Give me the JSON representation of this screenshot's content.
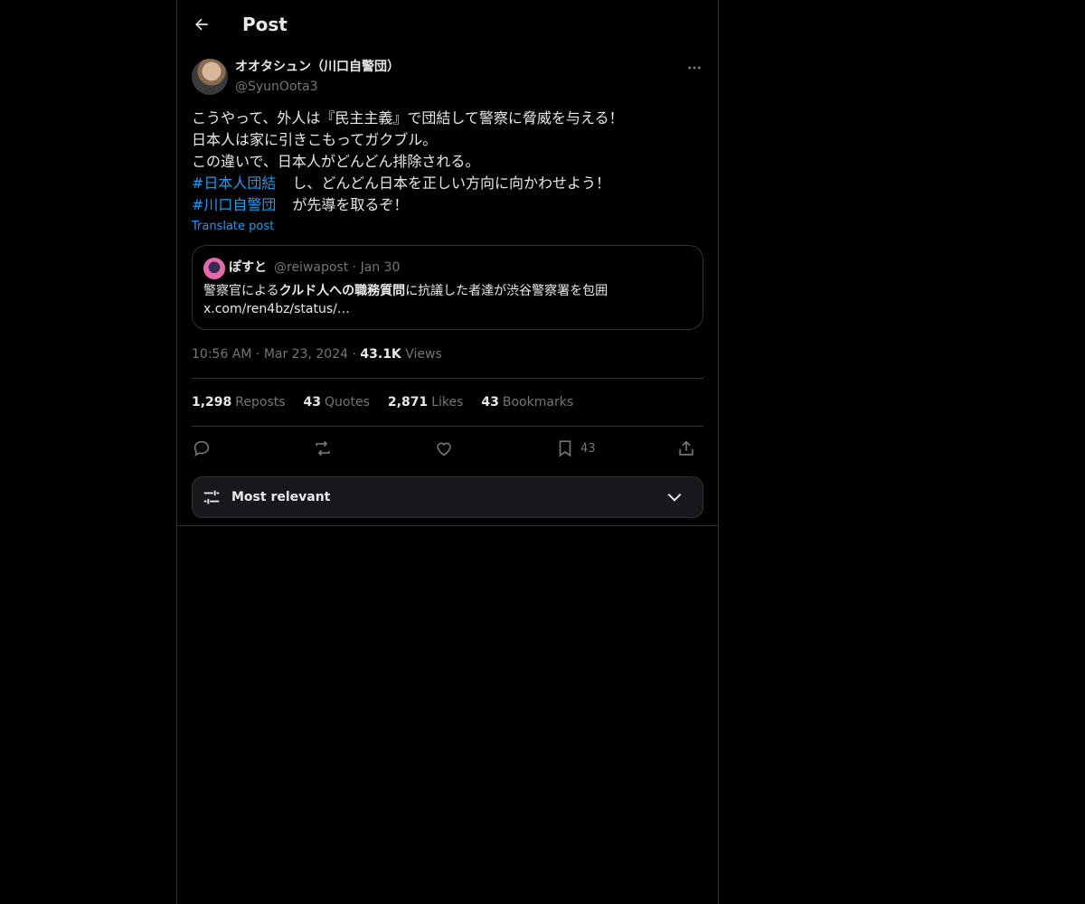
{
  "header": {
    "title": "Post"
  },
  "author": {
    "display_name": "オオタシュン（川口自警団）",
    "handle": "@SyunOota3"
  },
  "tweet": {
    "line1": "こうやって、外人は『民主主義』で団結して警察に脅威を与える！",
    "line2": "日本人は家に引きこもってガクブル。",
    "line3": "この違いで、日本人がどんどん排除される。",
    "hashtag1": "#日本人団結",
    "line4_rest": "し、どんどん日本を正しい方向に向かわせよう！",
    "hashtag2": "#川口自警団",
    "line5_rest": "が先導を取るぞ！",
    "translate_label": "Translate post"
  },
  "quote": {
    "name": "ぽすと",
    "handle": "@reiwapost",
    "separator": "·",
    "date": "Jan 30",
    "text_pre": "警察官による",
    "text_bold": "クルド人への職務質問",
    "text_post": "に抗議した者達が渋谷警察署を包囲",
    "link": "x.com/ren4bz/status/…"
  },
  "meta": {
    "time": "10:56 AM",
    "sep1": "·",
    "date": "Mar 23, 2024",
    "sep2": "·",
    "views_count": "43.1K",
    "views_label": "Views"
  },
  "stats": {
    "reposts_count": "1,298",
    "reposts_label": "Reposts",
    "quotes_count": "43",
    "quotes_label": "Quotes",
    "likes_count": "2,871",
    "likes_label": "Likes",
    "bookmarks_count": "43",
    "bookmarks_label": "Bookmarks"
  },
  "actions": {
    "bookmark_count": "43",
    "icons": [
      "reply-icon",
      "repost-icon",
      "like-icon",
      "bookmark-icon",
      "share-icon"
    ]
  },
  "sort": {
    "label": "Most relevant"
  },
  "colors": {
    "background": "#000000",
    "text": "#e7e9ea",
    "muted": "#71767b",
    "link": "#1d9bf0",
    "border": "#2f3336"
  }
}
